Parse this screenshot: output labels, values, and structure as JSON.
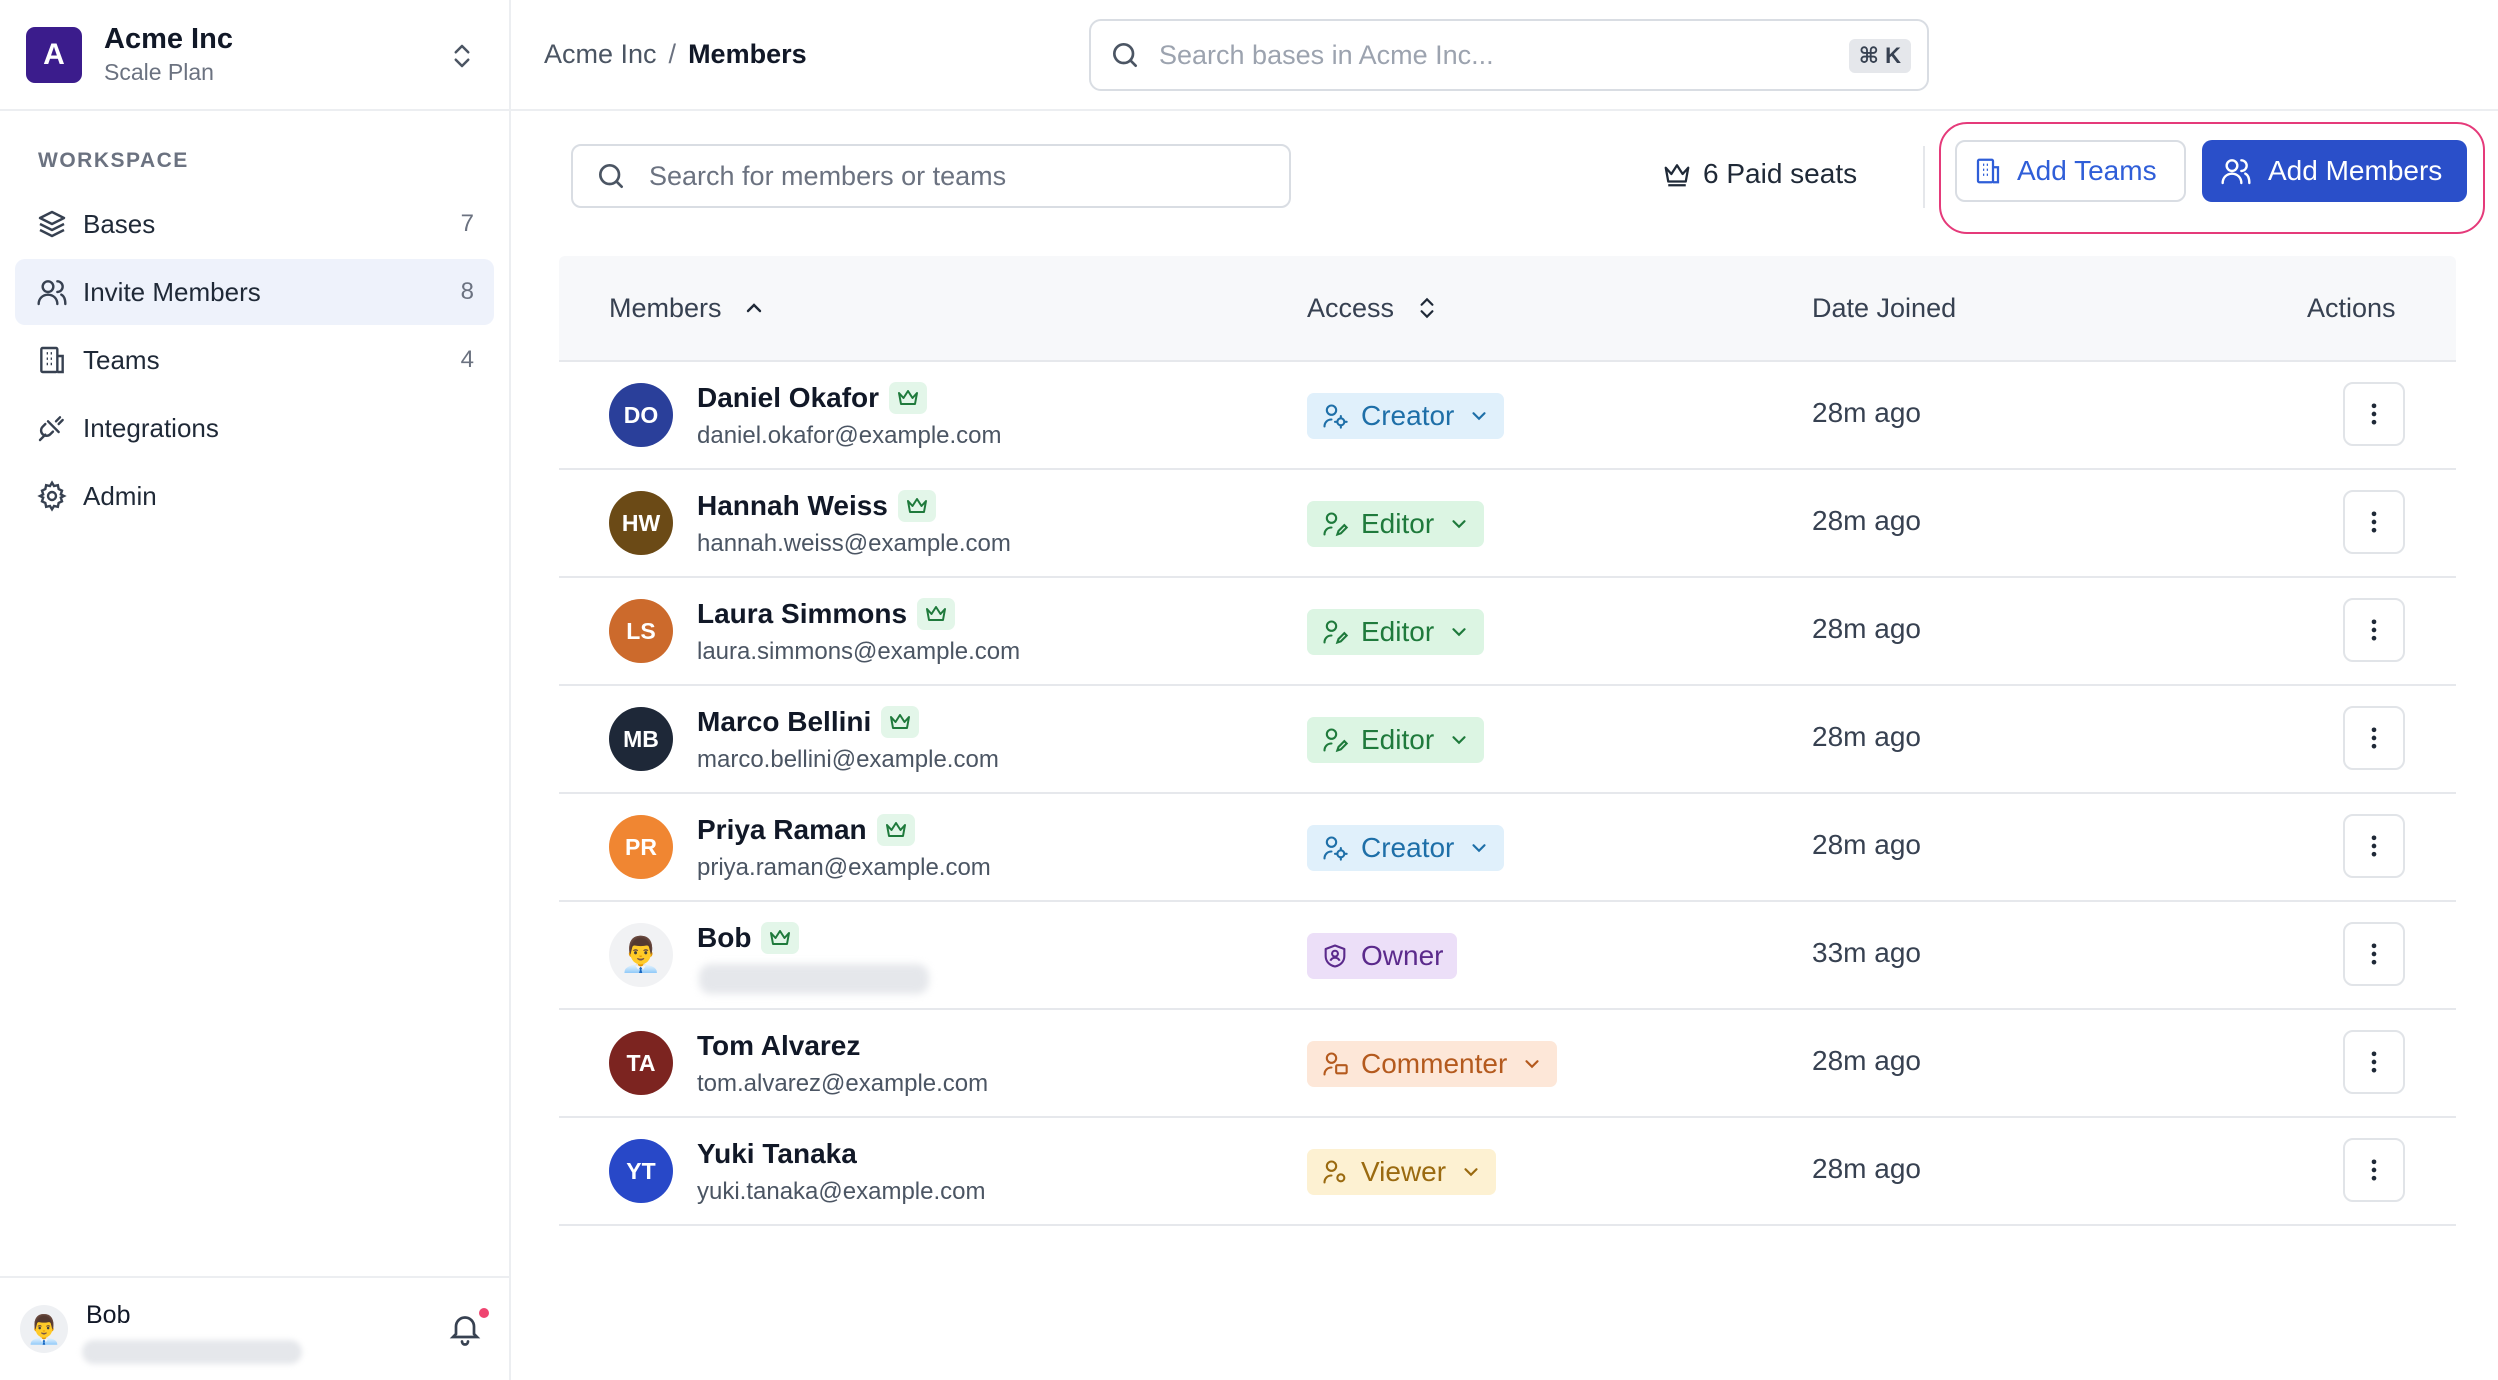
{
  "workspace": {
    "logo_letter": "A",
    "name": "Acme Inc",
    "plan": "Scale Plan"
  },
  "sidebar": {
    "section_label": "WORKSPACE",
    "items": [
      {
        "label": "Bases",
        "count": "7",
        "icon": "layers-icon"
      },
      {
        "label": "Invite Members",
        "count": "8",
        "icon": "users-icon",
        "active": true
      },
      {
        "label": "Teams",
        "count": "4",
        "icon": "building-icon"
      },
      {
        "label": "Integrations",
        "count": "",
        "icon": "plug-icon"
      },
      {
        "label": "Admin",
        "count": "",
        "icon": "gear-icon"
      }
    ]
  },
  "user": {
    "name": "Bob",
    "avatar_emoji": "👨‍💼"
  },
  "topbar": {
    "breadcrumb_root": "Acme Inc",
    "breadcrumb_sep": "/",
    "breadcrumb_current": "Members",
    "search_placeholder": "Search bases in Acme Inc...",
    "shortcut": "⌘ K"
  },
  "toolbar": {
    "search_placeholder": "Search for members or teams",
    "seats_label": "6 Paid seats",
    "add_teams_label": "Add Teams",
    "add_members_label": "Add Members"
  },
  "table": {
    "headers": {
      "members": "Members",
      "access": "Access",
      "date_joined": "Date Joined",
      "actions": "Actions"
    },
    "rows": [
      {
        "initials": "DO",
        "name": "Daniel Okafor",
        "email": "daniel.okafor@example.com",
        "access": "Creator",
        "date": "28m ago",
        "avatar_color": "#2a3f9a"
      },
      {
        "initials": "HW",
        "name": "Hannah Weiss",
        "email": "hannah.weiss@example.com",
        "access": "Editor",
        "date": "28m ago",
        "avatar_color": "#6b4a16"
      },
      {
        "initials": "LS",
        "name": "Laura Simmons",
        "email": "laura.simmons@example.com",
        "access": "Editor",
        "date": "28m ago",
        "avatar_color": "#cc6a2c"
      },
      {
        "initials": "MB",
        "name": "Marco Bellini",
        "email": "marco.bellini@example.com",
        "access": "Editor",
        "date": "28m ago",
        "avatar_color": "#1e2838"
      },
      {
        "initials": "PR",
        "name": "Priya Raman",
        "email": "priya.raman@example.com",
        "access": "Creator",
        "date": "28m ago",
        "avatar_color": "#f08632"
      },
      {
        "initials": "",
        "name": "Bob",
        "email": "",
        "access": "Owner",
        "date": "33m ago",
        "avatar_color": "#f1f2f4",
        "avatar_emoji": "👨‍💼"
      },
      {
        "initials": "TA",
        "name": "Tom Alvarez",
        "email": "tom.alvarez@example.com",
        "access": "Commenter",
        "date": "28m ago",
        "avatar_color": "#7c2420"
      },
      {
        "initials": "YT",
        "name": "Yuki Tanaka",
        "email": "yuki.tanaka@example.com",
        "access": "Viewer",
        "date": "28m ago",
        "avatar_color": "#2848c8"
      }
    ]
  },
  "colors": {
    "accent": "#2a4fc9",
    "highlight": "#e53a7a",
    "creator_bg": "#e0f0fb",
    "creator_fg": "#1e6fa8",
    "editor_bg": "#dcf5e3",
    "editor_fg": "#1f7a3c",
    "owner_bg": "#ecdff8",
    "owner_fg": "#5b2a8c",
    "commenter_bg": "#fde7d8",
    "commenter_fg": "#b45a1e",
    "viewer_bg": "#fdf1d2",
    "viewer_fg": "#9a6a10"
  }
}
